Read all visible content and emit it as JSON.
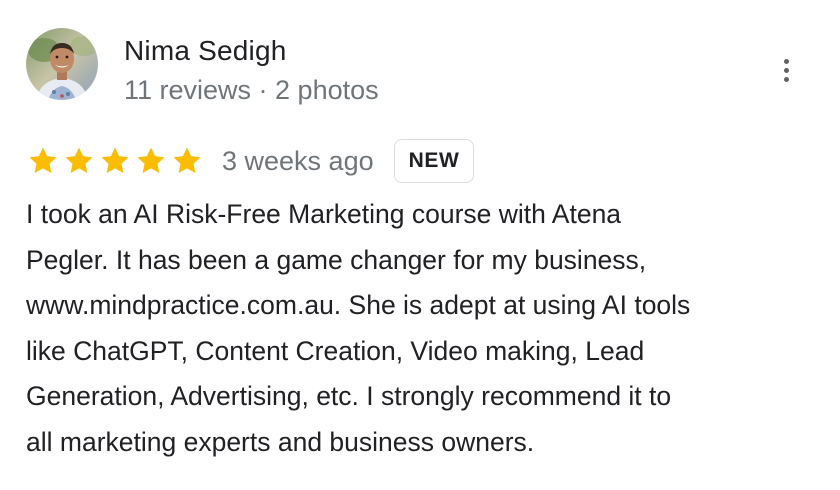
{
  "review": {
    "author": {
      "name": "Nima Sedigh",
      "meta": "11 reviews · 2 photos"
    },
    "menu_icon": "more-vertical-icon",
    "rating": {
      "stars": 5,
      "max_stars": 5,
      "star_icon": "star-icon",
      "star_color": "#fbbc04"
    },
    "time_ago": "3 weeks ago",
    "badge": "NEW",
    "text_lines": [
      "I took an AI Risk-Free Marketing course with Atena",
      "Pegler. It has been a game changer for my business,",
      "www.mindpractice.com.au. She is adept at using AI tools",
      "like ChatGPT, Content Creation, Video making, Lead",
      "Generation, Advertising, etc. I strongly recommend it to",
      "all marketing experts and business owners."
    ]
  },
  "colors": {
    "primary_text": "#202124",
    "secondary_text": "#70757a",
    "star": "#fbbc04",
    "badge_border": "#dadce0"
  }
}
